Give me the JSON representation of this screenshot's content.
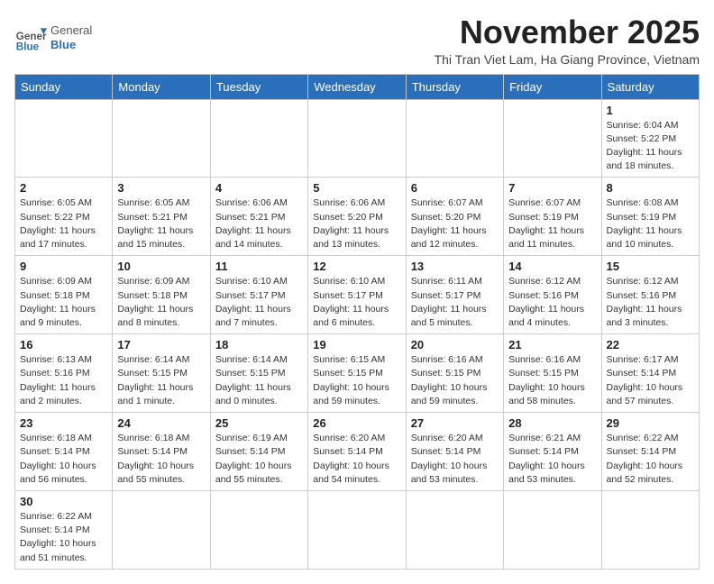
{
  "header": {
    "logo_general": "General",
    "logo_blue": "Blue",
    "month_title": "November 2025",
    "subtitle": "Thi Tran Viet Lam, Ha Giang Province, Vietnam"
  },
  "weekdays": [
    "Sunday",
    "Monday",
    "Tuesday",
    "Wednesday",
    "Thursday",
    "Friday",
    "Saturday"
  ],
  "weeks": [
    [
      {
        "day": "",
        "info": ""
      },
      {
        "day": "",
        "info": ""
      },
      {
        "day": "",
        "info": ""
      },
      {
        "day": "",
        "info": ""
      },
      {
        "day": "",
        "info": ""
      },
      {
        "day": "",
        "info": ""
      },
      {
        "day": "1",
        "info": "Sunrise: 6:04 AM\nSunset: 5:22 PM\nDaylight: 11 hours and 18 minutes."
      }
    ],
    [
      {
        "day": "2",
        "info": "Sunrise: 6:05 AM\nSunset: 5:22 PM\nDaylight: 11 hours and 17 minutes."
      },
      {
        "day": "3",
        "info": "Sunrise: 6:05 AM\nSunset: 5:21 PM\nDaylight: 11 hours and 15 minutes."
      },
      {
        "day": "4",
        "info": "Sunrise: 6:06 AM\nSunset: 5:21 PM\nDaylight: 11 hours and 14 minutes."
      },
      {
        "day": "5",
        "info": "Sunrise: 6:06 AM\nSunset: 5:20 PM\nDaylight: 11 hours and 13 minutes."
      },
      {
        "day": "6",
        "info": "Sunrise: 6:07 AM\nSunset: 5:20 PM\nDaylight: 11 hours and 12 minutes."
      },
      {
        "day": "7",
        "info": "Sunrise: 6:07 AM\nSunset: 5:19 PM\nDaylight: 11 hours and 11 minutes."
      },
      {
        "day": "8",
        "info": "Sunrise: 6:08 AM\nSunset: 5:19 PM\nDaylight: 11 hours and 10 minutes."
      }
    ],
    [
      {
        "day": "9",
        "info": "Sunrise: 6:09 AM\nSunset: 5:18 PM\nDaylight: 11 hours and 9 minutes."
      },
      {
        "day": "10",
        "info": "Sunrise: 6:09 AM\nSunset: 5:18 PM\nDaylight: 11 hours and 8 minutes."
      },
      {
        "day": "11",
        "info": "Sunrise: 6:10 AM\nSunset: 5:17 PM\nDaylight: 11 hours and 7 minutes."
      },
      {
        "day": "12",
        "info": "Sunrise: 6:10 AM\nSunset: 5:17 PM\nDaylight: 11 hours and 6 minutes."
      },
      {
        "day": "13",
        "info": "Sunrise: 6:11 AM\nSunset: 5:17 PM\nDaylight: 11 hours and 5 minutes."
      },
      {
        "day": "14",
        "info": "Sunrise: 6:12 AM\nSunset: 5:16 PM\nDaylight: 11 hours and 4 minutes."
      },
      {
        "day": "15",
        "info": "Sunrise: 6:12 AM\nSunset: 5:16 PM\nDaylight: 11 hours and 3 minutes."
      }
    ],
    [
      {
        "day": "16",
        "info": "Sunrise: 6:13 AM\nSunset: 5:16 PM\nDaylight: 11 hours and 2 minutes."
      },
      {
        "day": "17",
        "info": "Sunrise: 6:14 AM\nSunset: 5:15 PM\nDaylight: 11 hours and 1 minute."
      },
      {
        "day": "18",
        "info": "Sunrise: 6:14 AM\nSunset: 5:15 PM\nDaylight: 11 hours and 0 minutes."
      },
      {
        "day": "19",
        "info": "Sunrise: 6:15 AM\nSunset: 5:15 PM\nDaylight: 10 hours and 59 minutes."
      },
      {
        "day": "20",
        "info": "Sunrise: 6:16 AM\nSunset: 5:15 PM\nDaylight: 10 hours and 59 minutes."
      },
      {
        "day": "21",
        "info": "Sunrise: 6:16 AM\nSunset: 5:15 PM\nDaylight: 10 hours and 58 minutes."
      },
      {
        "day": "22",
        "info": "Sunrise: 6:17 AM\nSunset: 5:14 PM\nDaylight: 10 hours and 57 minutes."
      }
    ],
    [
      {
        "day": "23",
        "info": "Sunrise: 6:18 AM\nSunset: 5:14 PM\nDaylight: 10 hours and 56 minutes."
      },
      {
        "day": "24",
        "info": "Sunrise: 6:18 AM\nSunset: 5:14 PM\nDaylight: 10 hours and 55 minutes."
      },
      {
        "day": "25",
        "info": "Sunrise: 6:19 AM\nSunset: 5:14 PM\nDaylight: 10 hours and 55 minutes."
      },
      {
        "day": "26",
        "info": "Sunrise: 6:20 AM\nSunset: 5:14 PM\nDaylight: 10 hours and 54 minutes."
      },
      {
        "day": "27",
        "info": "Sunrise: 6:20 AM\nSunset: 5:14 PM\nDaylight: 10 hours and 53 minutes."
      },
      {
        "day": "28",
        "info": "Sunrise: 6:21 AM\nSunset: 5:14 PM\nDaylight: 10 hours and 53 minutes."
      },
      {
        "day": "29",
        "info": "Sunrise: 6:22 AM\nSunset: 5:14 PM\nDaylight: 10 hours and 52 minutes."
      }
    ],
    [
      {
        "day": "30",
        "info": "Sunrise: 6:22 AM\nSunset: 5:14 PM\nDaylight: 10 hours and 51 minutes."
      },
      {
        "day": "",
        "info": ""
      },
      {
        "day": "",
        "info": ""
      },
      {
        "day": "",
        "info": ""
      },
      {
        "day": "",
        "info": ""
      },
      {
        "day": "",
        "info": ""
      },
      {
        "day": "",
        "info": ""
      }
    ]
  ]
}
